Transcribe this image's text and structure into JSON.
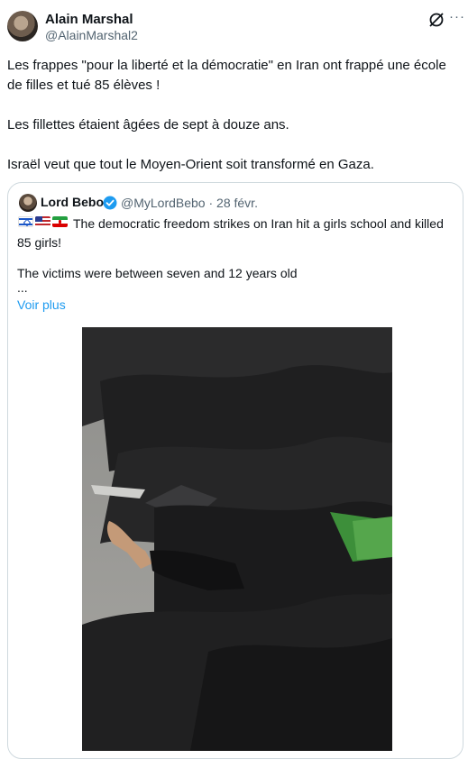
{
  "tweet": {
    "author_name": "Alain Marshal",
    "author_handle": "@AlainMarshal2",
    "more_label": "···",
    "text": "Les frappes \"pour la liberté et la démocratie\" en Iran ont frappé une école de filles et tué 85 élèves !\n\nLes fillettes étaient âgées de sept à douze ans.\n\nIsraël veut que tout le Moyen-Orient soit transformé en Gaza."
  },
  "quote": {
    "author_name": "Lord Bebo",
    "author_handle": "@MyLordBebo",
    "separator": "·",
    "date": "28 févr.",
    "text_line1": "The democratic freedom strikes on Iran hit a girls school and killed 85 girls!",
    "text_line2": "The victims were between seven and 12 years old",
    "ellipsis": "...",
    "show_more": "Voir plus",
    "flags": [
      "israel-flag",
      "usa-flag",
      "iran-flag"
    ]
  },
  "colors": {
    "text": "#0f1419",
    "secondary": "#536471",
    "link": "#1d9bf0",
    "border": "#cfd9de"
  }
}
